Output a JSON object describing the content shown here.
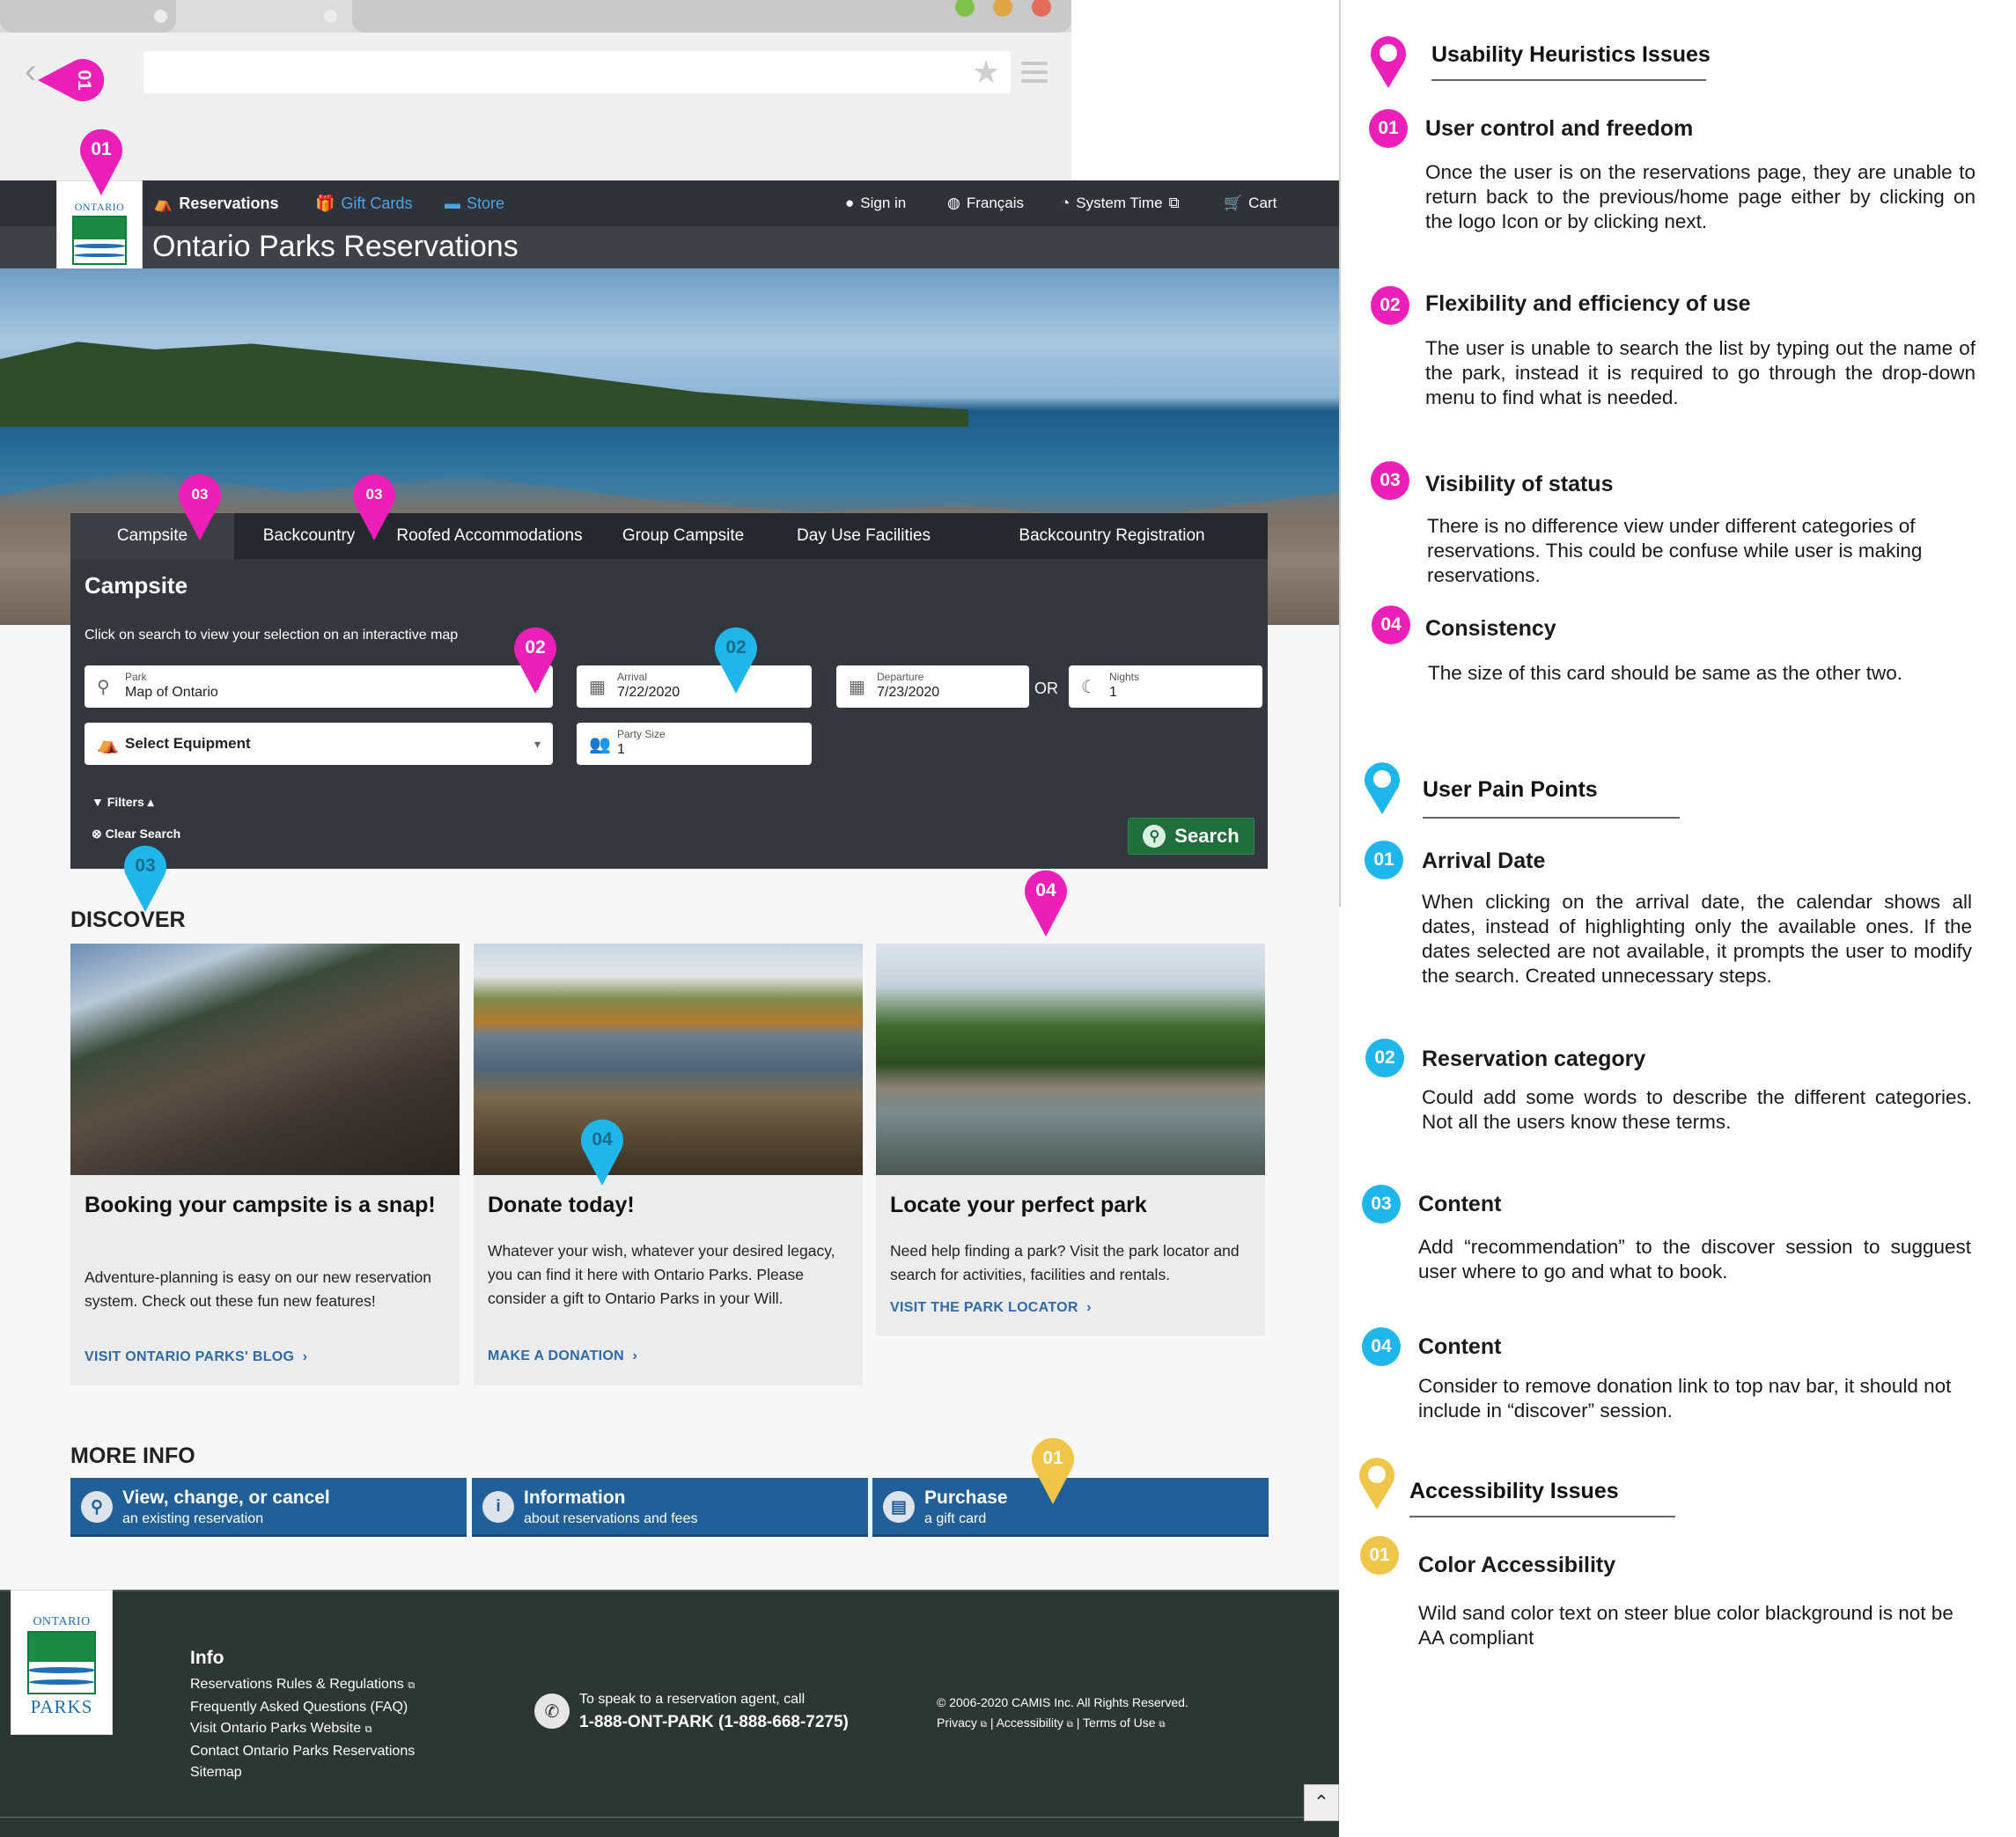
{
  "site": {
    "nav": {
      "reservations": "Reservations",
      "gift_cards": "Gift Cards",
      "store": "Store",
      "sign_in": "Sign in",
      "francais": "Français",
      "system_time": "System Time",
      "cart": "Cart"
    },
    "logo": {
      "top": "ONTARIO",
      "bottom": "PARKS"
    },
    "page_title": "Ontario Parks Reservations",
    "tabs": [
      "Campsite",
      "Backcountry",
      "Roofed Accommodations",
      "Group Campsite",
      "Day Use Facilities",
      "Backcountry Registration"
    ],
    "search": {
      "heading": "Campsite",
      "hint": "Click on search to view your selection on an interactive map",
      "park_label": "Park",
      "park_value": "Map of Ontario",
      "arrival_label": "Arrival",
      "arrival_value": "7/22/2020",
      "departure_label": "Departure",
      "departure_value": "7/23/2020",
      "or": "OR",
      "nights_label": "Nights",
      "nights_value": "1",
      "equipment": "Select Equipment",
      "party_label": "Party Size",
      "party_value": "1",
      "filters": "Filters",
      "clear": "Clear Search",
      "search_button": "Search"
    },
    "discover": {
      "heading": "DISCOVER",
      "cards": [
        {
          "title": "Booking your campsite is a snap!",
          "body": "Adventure-planning is easy on our new reservation system. Check out these fun new features!",
          "link": "VISIT ONTARIO PARKS' BLOG"
        },
        {
          "title": "Donate today!",
          "body": "Whatever your wish, whatever your desired legacy, you can find it here with Ontario Parks. Please consider a gift to Ontario Parks in your Will.",
          "link": "MAKE A DONATION"
        },
        {
          "title": "Locate your perfect park",
          "body": "Need help finding a park? Visit the park locator and search for activities, facilities and rentals.",
          "link": "VISIT THE PARK LOCATOR"
        }
      ]
    },
    "more_info": {
      "heading": "MORE INFO",
      "buttons": [
        {
          "title": "View, change, or cancel",
          "subtitle": "an existing reservation"
        },
        {
          "title": "Information",
          "subtitle": "about reservations and fees"
        },
        {
          "title": "Purchase",
          "subtitle": "a gift card"
        }
      ]
    },
    "footer": {
      "info_heading": "Info",
      "links": [
        "Reservations Rules & Regulations",
        "Frequently Asked Questions (FAQ)",
        "Visit Ontario Parks Website",
        "Contact Ontario Parks Reservations",
        "Sitemap"
      ],
      "phone_line1": "To speak to a reservation agent, call",
      "phone_line2": "1-888-ONT-PARK (1-888-668-7275)",
      "copyright": "© 2006-2020 CAMIS Inc. All Rights Reserved.",
      "legal": [
        "Privacy",
        "Accessibility",
        "Terms of Use"
      ]
    }
  },
  "pins": [
    "01",
    "01",
    "02",
    "03",
    "02",
    "02",
    "03",
    "04",
    "04",
    "01"
  ],
  "annotations": {
    "usability": {
      "heading": "Usability Heuristics Issues",
      "items": [
        {
          "num": "01",
          "title": "User control and freedom",
          "body": "Once the user is on the reservations page, they are unable to return back to the previous/home page either by clicking on the logo Icon or by clicking next."
        },
        {
          "num": "02",
          "title": "Flexibility and efficiency of use",
          "body": "The user is unable to search the list by typing out the name of the park, instead it is required to go through the drop-down menu to find what is needed."
        },
        {
          "num": "03",
          "title": "Visibility  of status",
          "body": "There is no difference view under different categories of reservations. This could be confuse while user is making reservations."
        },
        {
          "num": "04",
          "title": "Consistency",
          "body": "The size of this card should be same as the other two."
        }
      ]
    },
    "pain": {
      "heading": "User Pain Points",
      "items": [
        {
          "num": "01",
          "title": "Arrival Date",
          "body": "When clicking on the arrival date, the calendar shows all dates, instead of highlighting only the available ones. If the dates selected are not available, it prompts the user to modify the search. Created unnecessary steps."
        },
        {
          "num": "02",
          "title": "Reservation category",
          "body": "Could add some words to describe the different categories. Not all the users know these terms."
        },
        {
          "num": "03",
          "title": "Content",
          "body": "Add “recommendation” to the discover session to sugguest user where to go and what to book."
        },
        {
          "num": "04",
          "title": "Content",
          "body": "Consider to remove donation link to top nav bar, it should not include in “discover” session."
        }
      ]
    },
    "accessibility": {
      "heading": "Accessibility Issues",
      "items": [
        {
          "num": "01",
          "title": "Color Accessibility",
          "body": "Wild sand color text on steer blue color blackground  is not be AA compliant"
        }
      ]
    }
  },
  "colors": {
    "magenta": "#ec1fb8",
    "cyan": "#1fb6ea",
    "yellow": "#efc64a",
    "nav_dark": "#2f3238",
    "button_blue": "#215f99",
    "search_green": "#1e6f3b",
    "footer": "#2c3632"
  }
}
